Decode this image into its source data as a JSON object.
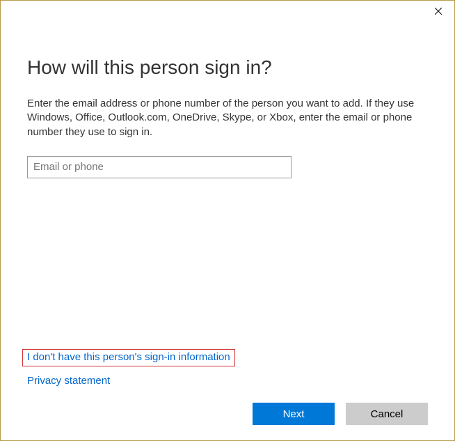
{
  "dialog": {
    "heading": "How will this person sign in?",
    "description": "Enter the email address or phone number of the person you want to add. If they use Windows, Office, Outlook.com, OneDrive, Skype, or Xbox, enter the email or phone number they use to sign in.",
    "input_placeholder": "Email or phone",
    "input_value": "",
    "link_no_info": "I don't have this person's sign-in information",
    "link_privacy": "Privacy statement",
    "button_next": "Next",
    "button_cancel": "Cancel"
  }
}
